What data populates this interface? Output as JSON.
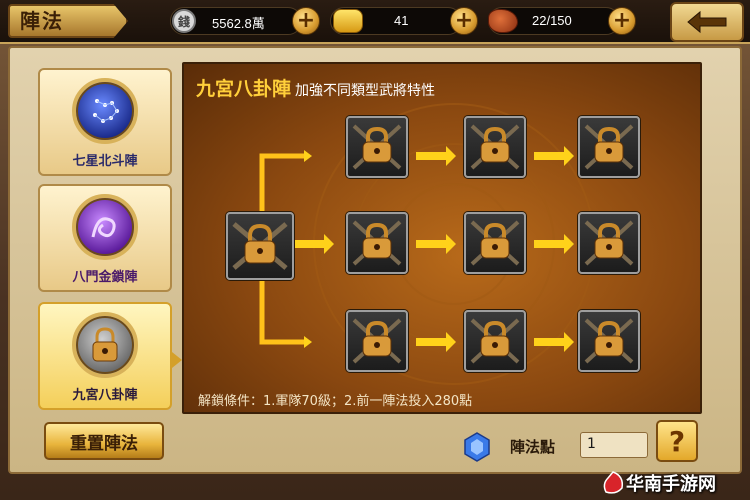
{
  "title": "陣法",
  "resources": [
    {
      "icon": "silver-coin-icon",
      "value": "5562.8萬"
    },
    {
      "icon": "gold-ingot-icon",
      "value": "41"
    },
    {
      "icon": "meat-stamina-icon",
      "value": "22/150"
    }
  ],
  "back_icon": "back-arrow-icon",
  "formations": [
    {
      "label": "七星北斗陣",
      "orb_color": "#3a5ad8"
    },
    {
      "label": "八門金鎖陣",
      "orb_color": "#8a3ad0"
    },
    {
      "label": "九宮八卦陣",
      "orb_color": "#7a7a7a"
    }
  ],
  "board": {
    "name": "九宮八卦陣",
    "subtitle": "加強不同類型武將特性",
    "unlock_condition": "解鎖條件：1.軍隊70級；2.前一陣法投入280點"
  },
  "reset_label": "重置陣法",
  "points_label": "陣法點",
  "points_value": "1",
  "help_label": "?",
  "watermark": "华南手游网",
  "colors": {
    "accent": "#ffcf3a",
    "arrow": "#ffd21a"
  }
}
